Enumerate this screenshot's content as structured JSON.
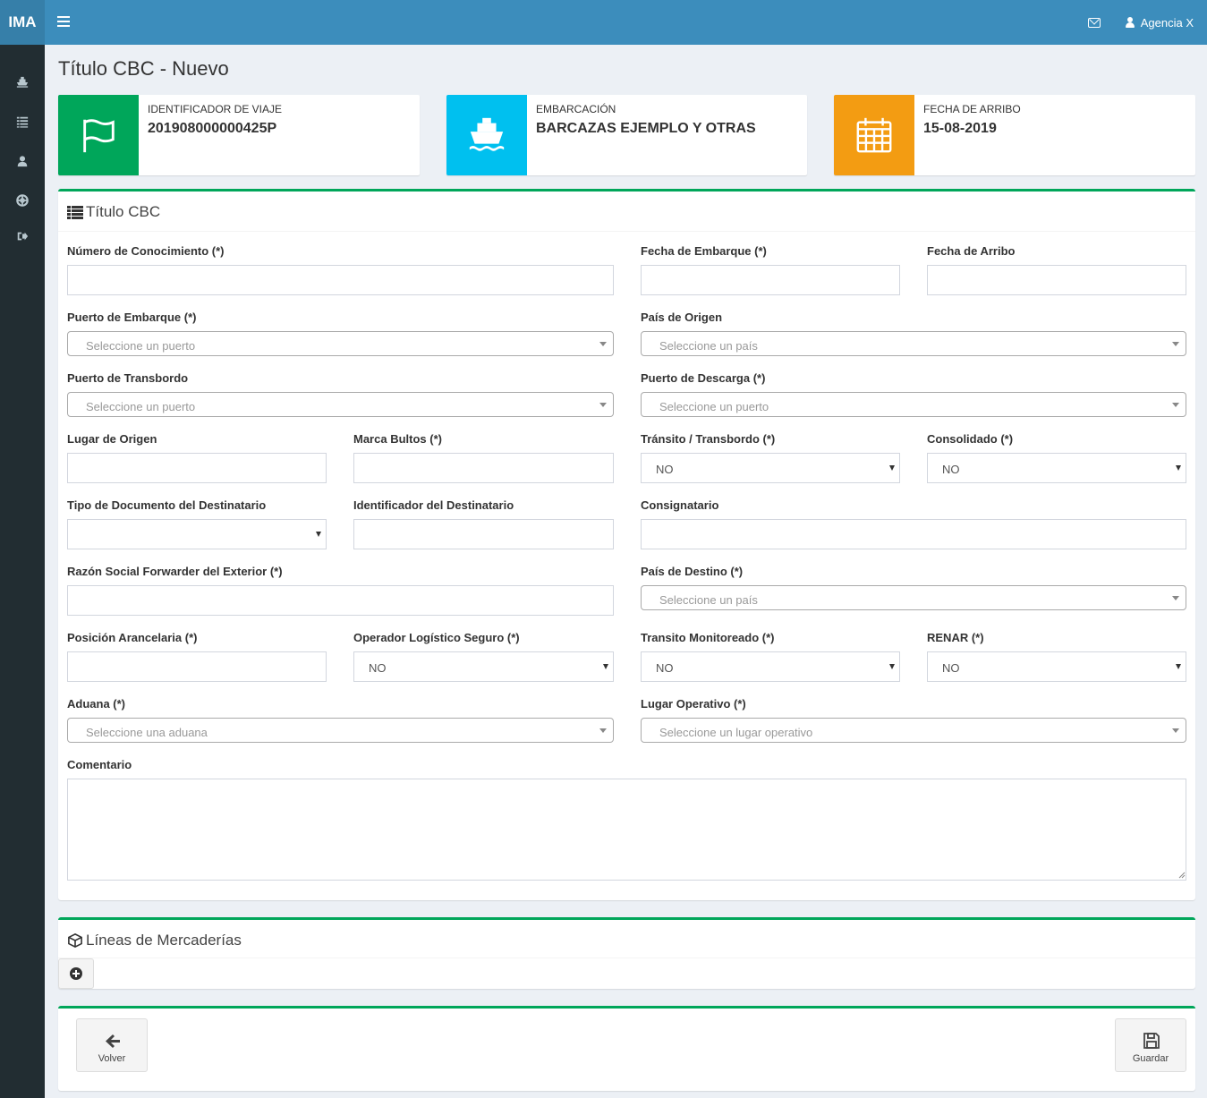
{
  "app": {
    "logo": "IMA",
    "user_name": "Agencia X"
  },
  "icons": {
    "menu": "hamburger-icon",
    "mail": "envelope-icon",
    "user": "user-icon"
  },
  "sidebar": {
    "items": [
      "ship-icon",
      "list-icon",
      "user-icon",
      "life-ring-icon",
      "sign-out-icon"
    ]
  },
  "page": {
    "title": "Título CBC - Nuevo"
  },
  "info_boxes": [
    {
      "label": "IDENTIFICADOR DE VIAJE",
      "value": "201908000000425P",
      "icon": "flag-icon",
      "color": "#00a65a"
    },
    {
      "label": "EMBARCACIÓN",
      "value": "BARCAZAS EJEMPLO Y OTRAS",
      "icon": "ship-icon",
      "color": "#00c0ef"
    },
    {
      "label": "FECHA DE ARRIBO",
      "value": "15-08-2019",
      "icon": "calendar-icon",
      "color": "#f39c12"
    }
  ],
  "form": {
    "title": "Título CBC",
    "fields": {
      "numero_conocimiento": {
        "label": "Número de Conocimiento (*)",
        "value": ""
      },
      "fecha_embarque": {
        "label": "Fecha de Embarque (*)",
        "value": ""
      },
      "fecha_arribo": {
        "label": "Fecha de Arribo",
        "value": ""
      },
      "puerto_embarque": {
        "label": "Puerto de Embarque (*)",
        "placeholder": "Seleccione un puerto"
      },
      "pais_origen": {
        "label": "País de Origen",
        "placeholder": "Seleccione un país"
      },
      "puerto_transbordo": {
        "label": "Puerto de Transbordo",
        "placeholder": "Seleccione un puerto"
      },
      "puerto_descarga": {
        "label": "Puerto de Descarga (*)",
        "placeholder": "Seleccione un puerto"
      },
      "lugar_origen": {
        "label": "Lugar de Origen",
        "value": ""
      },
      "marca_bultos": {
        "label": "Marca Bultos (*)",
        "value": ""
      },
      "transito_transbordo": {
        "label": "Tránsito / Transbordo (*)",
        "value": "NO"
      },
      "consolidado": {
        "label": "Consolidado (*)",
        "value": "NO"
      },
      "tipo_documento": {
        "label": "Tipo de Documento del Destinatario",
        "value": ""
      },
      "identificador_destinatario": {
        "label": "Identificador del Destinatario",
        "value": ""
      },
      "consignatario": {
        "label": "Consignatario",
        "value": ""
      },
      "razon_social": {
        "label": "Razón Social Forwarder del Exterior (*)",
        "value": ""
      },
      "pais_destino": {
        "label": "País de Destino (*)",
        "placeholder": "Seleccione un país"
      },
      "posicion_arancelaria": {
        "label": "Posición Arancelaria (*)",
        "value": ""
      },
      "operador_logistico": {
        "label": "Operador Logístico Seguro (*)",
        "value": "NO"
      },
      "transito_monitoreado": {
        "label": "Transito Monitoreado (*)",
        "value": "NO"
      },
      "renar": {
        "label": "RENAR (*)",
        "value": "NO"
      },
      "aduana": {
        "label": "Aduana (*)",
        "placeholder": "Seleccione una aduana"
      },
      "lugar_operativo": {
        "label": "Lugar Operativo (*)",
        "placeholder": "Seleccione un lugar operativo"
      },
      "comentario": {
        "label": "Comentario",
        "value": ""
      }
    }
  },
  "lineas": {
    "title": "Líneas de Mercaderías"
  },
  "actions": {
    "back_label": "Volver",
    "save_label": "Guardar"
  },
  "colors": {
    "header": "#3c8dbc",
    "sidebar": "#222d32",
    "box_border": "#00a65a"
  }
}
